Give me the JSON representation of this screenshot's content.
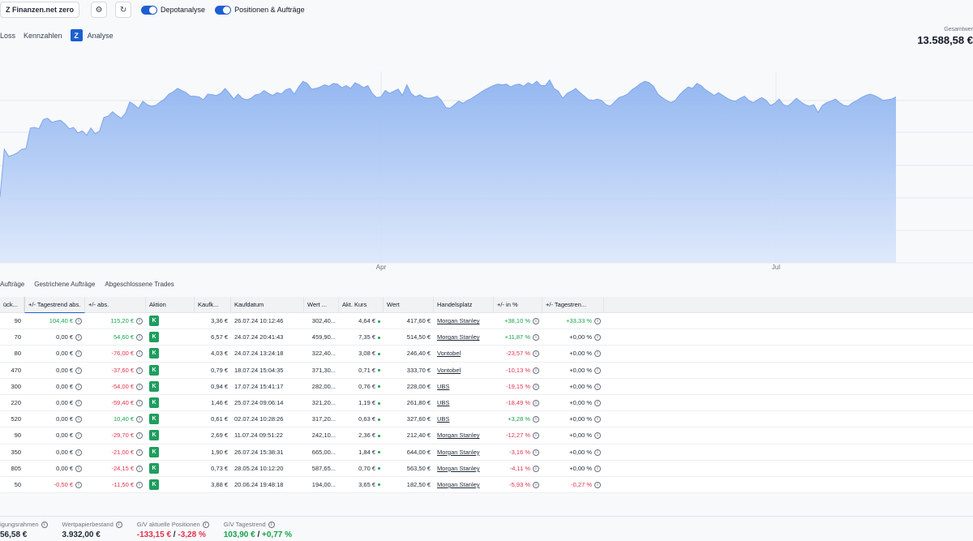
{
  "topbar": {
    "account": "Z Finanzen.net zero",
    "settings_icon": "gear-icon",
    "refresh_icon": "refresh-icon",
    "toggle1": "Depotanalyse",
    "toggle2": "Positionen & Aufträge"
  },
  "tabs": [
    "Loss",
    "Kennzahlen",
    "Analyse"
  ],
  "total": {
    "label": "Gesamtwer",
    "value": "13.588,58 €"
  },
  "chart_data": {
    "type": "area",
    "x_tick_labels": [
      "Apr",
      "Jul"
    ],
    "values": [
      93,
      160,
      150,
      152,
      155,
      160,
      161,
      190,
      191,
      189,
      202,
      204,
      198,
      200,
      201,
      196,
      189,
      191,
      183,
      186,
      180,
      190,
      182,
      186,
      205,
      207,
      213,
      208,
      204,
      211,
      227,
      223,
      218,
      228,
      223,
      221,
      222,
      227,
      231,
      238,
      241,
      246,
      243,
      240,
      235,
      235,
      234,
      230,
      238,
      237,
      236,
      239,
      246,
      239,
      231,
      238,
      232,
      230,
      232,
      237,
      238,
      243,
      239,
      236,
      240,
      238,
      244,
      246,
      238,
      248,
      256,
      253,
      245,
      246,
      248,
      251,
      249,
      253,
      252,
      247,
      250,
      246,
      254,
      251,
      247,
      250,
      239,
      233,
      234,
      243,
      239,
      242,
      245,
      236,
      251,
      239,
      234,
      237,
      233,
      232,
      233,
      235,
      229,
      219,
      218,
      223,
      228,
      225,
      229,
      232,
      236,
      240,
      244,
      247,
      250,
      252,
      251,
      252,
      248,
      251,
      252,
      249,
      254,
      251,
      256,
      250,
      250,
      258,
      246,
      242,
      232,
      239,
      242,
      246,
      240,
      235,
      230,
      229,
      231,
      229,
      223,
      221,
      227,
      233,
      235,
      238,
      244,
      248,
      253,
      256,
      254,
      249,
      238,
      233,
      229,
      226,
      229,
      237,
      243,
      248,
      246,
      253,
      250,
      244,
      240,
      236,
      240,
      236,
      232,
      229,
      228,
      232,
      235,
      229,
      226,
      230,
      233,
      229,
      222,
      225,
      231,
      223,
      221,
      226,
      232,
      227,
      223,
      221,
      223,
      212,
      222,
      226,
      228,
      231,
      226,
      222,
      221,
      226,
      229,
      233,
      236,
      238,
      236,
      233,
      229,
      230,
      231,
      234
    ]
  },
  "subtabs": [
    "Aufträge",
    "Gestrichene Aufträge",
    "Abgeschlossene Trades"
  ],
  "table": {
    "headers": [
      "ück...",
      "+/- Tagestrend abs.",
      "+/- abs.",
      "Aktion",
      "Kaufk...",
      "Kaufdatum",
      "Wert ...",
      "Akt. Kurs",
      "Wert",
      "Handelsplatz",
      "+/- in %",
      "+/- Tagestren..."
    ],
    "action_label": "K",
    "rows": [
      {
        "qty": "90",
        "day_abs": "104,40 €",
        "day_abs_sign": "pos",
        "abs": "115,20 €",
        "abs_sign": "pos",
        "buy_price": "3,36 €",
        "buy_date": "26.07.24 10:12:46",
        "buy_value": "302,40...",
        "price": "4,64 €",
        "value": "417,60 €",
        "venue": "Morgan Stanley",
        "pct": "+38,10 %",
        "pct_sign": "pos",
        "day_pct": "+33,33 %",
        "day_pct_sign": "pos"
      },
      {
        "qty": "70",
        "day_abs": "0,00 €",
        "day_abs_sign": "neutral",
        "abs": "54,60 €",
        "abs_sign": "pos",
        "buy_price": "6,57 €",
        "buy_date": "24.07.24 20:41:43",
        "buy_value": "459,90...",
        "price": "7,35 €",
        "value": "514,50 €",
        "venue": "Morgan Stanley",
        "pct": "+11,87 %",
        "pct_sign": "pos",
        "day_pct": "+0,00 %",
        "day_pct_sign": "neutral"
      },
      {
        "qty": "80",
        "day_abs": "0,00 €",
        "day_abs_sign": "neutral",
        "abs": "-76,00 €",
        "abs_sign": "neg",
        "buy_price": "4,03 €",
        "buy_date": "24.07.24 13:24:18",
        "buy_value": "322,40...",
        "price": "3,08 €",
        "value": "246,40 €",
        "venue": "Vontobel",
        "pct": "-23,57 %",
        "pct_sign": "neg",
        "day_pct": "+0,00 %",
        "day_pct_sign": "neutral"
      },
      {
        "qty": "470",
        "day_abs": "0,00 €",
        "day_abs_sign": "neutral",
        "abs": "-37,60 €",
        "abs_sign": "neg",
        "buy_price": "0,79 €",
        "buy_date": "18.07.24 15:04:35",
        "buy_value": "371,30...",
        "price": "0,71 €",
        "value": "333,70 €",
        "venue": "Vontobel",
        "pct": "-10,13 %",
        "pct_sign": "neg",
        "day_pct": "+0,00 %",
        "day_pct_sign": "neutral"
      },
      {
        "qty": "300",
        "day_abs": "0,00 €",
        "day_abs_sign": "neutral",
        "abs": "-54,00 €",
        "abs_sign": "neg",
        "buy_price": "0,94 €",
        "buy_date": "17.07.24 15:41:17",
        "buy_value": "282,00...",
        "price": "0,76 €",
        "value": "228,00 €",
        "venue": "UBS",
        "pct": "-19,15 %",
        "pct_sign": "neg",
        "day_pct": "+0,00 %",
        "day_pct_sign": "neutral"
      },
      {
        "qty": "220",
        "day_abs": "0,00 €",
        "day_abs_sign": "neutral",
        "abs": "-59,40 €",
        "abs_sign": "neg",
        "buy_price": "1,46 €",
        "buy_date": "25.07.24 09:06:14",
        "buy_value": "321,20...",
        "price": "1,19 €",
        "value": "261,80 €",
        "venue": "UBS",
        "pct": "-18,49 %",
        "pct_sign": "neg",
        "day_pct": "+0,00 %",
        "day_pct_sign": "neutral"
      },
      {
        "qty": "520",
        "day_abs": "0,00 €",
        "day_abs_sign": "neutral",
        "abs": "10,40 €",
        "abs_sign": "pos",
        "buy_price": "0,61 €",
        "buy_date": "02.07.24 10:28:26",
        "buy_value": "317,20...",
        "price": "0,63 €",
        "value": "327,60 €",
        "venue": "UBS",
        "pct": "+3,28 %",
        "pct_sign": "pos",
        "day_pct": "+0,00 %",
        "day_pct_sign": "neutral"
      },
      {
        "qty": "90",
        "day_abs": "0,00 €",
        "day_abs_sign": "neutral",
        "abs": "-29,70 €",
        "abs_sign": "neg",
        "buy_price": "2,69 €",
        "buy_date": "11.07.24 09:51:22",
        "buy_value": "242,10...",
        "price": "2,36 €",
        "value": "212,40 €",
        "venue": "Morgan Stanley",
        "pct": "-12,27 %",
        "pct_sign": "neg",
        "day_pct": "+0,00 %",
        "day_pct_sign": "neutral"
      },
      {
        "qty": "350",
        "day_abs": "0,00 €",
        "day_abs_sign": "neutral",
        "abs": "-21,00 €",
        "abs_sign": "neg",
        "buy_price": "1,90 €",
        "buy_date": "26.07.24 15:38:31",
        "buy_value": "665,00...",
        "price": "1,84 €",
        "value": "644,00 €",
        "venue": "Morgan Stanley",
        "pct": "-3,16 %",
        "pct_sign": "neg",
        "day_pct": "+0,00 %",
        "day_pct_sign": "neutral"
      },
      {
        "qty": "805",
        "day_abs": "0,00 €",
        "day_abs_sign": "neutral",
        "abs": "-24,15 €",
        "abs_sign": "neg",
        "buy_price": "0,73 €",
        "buy_date": "28.05.24 10:12:20",
        "buy_value": "587,65...",
        "price": "0,70 €",
        "value": "563,50 €",
        "venue": "Morgan Stanley",
        "pct": "-4,11 %",
        "pct_sign": "neg",
        "day_pct": "+0,00 %",
        "day_pct_sign": "neutral"
      },
      {
        "qty": "50",
        "day_abs": "-0,50 €",
        "day_abs_sign": "neg",
        "abs": "-11,50 €",
        "abs_sign": "neg",
        "buy_price": "3,88 €",
        "buy_date": "20.06.24 19:48:18",
        "buy_value": "194,00...",
        "price": "3,65 €",
        "value": "182,50 €",
        "venue": "Morgan Stanley",
        "pct": "-5,93 %",
        "pct_sign": "neg",
        "day_pct": "-0,27 %",
        "day_pct_sign": "neg"
      }
    ]
  },
  "footer": {
    "items": [
      {
        "label": "igungsrahmen",
        "value": "56,58 €"
      },
      {
        "label": "Wertpapierbestand",
        "value": "3.932,00 €"
      },
      {
        "label": "G/V aktuelle Positionen",
        "value_a": "-133,15 €",
        "sep": " / ",
        "value_b": "-3,28 %",
        "sign": "neg"
      },
      {
        "label": "G/V Tagestrend",
        "value_a": "103,90 €",
        "sep": " / ",
        "value_b": "+0,77 %",
        "sign": "pos"
      }
    ]
  },
  "colors": {
    "accent": "#1d5fd1",
    "positive": "#16a34a",
    "negative": "#e0314b",
    "chart_fill": "#a7c4f2",
    "chart_line": "#7ea6ea"
  }
}
